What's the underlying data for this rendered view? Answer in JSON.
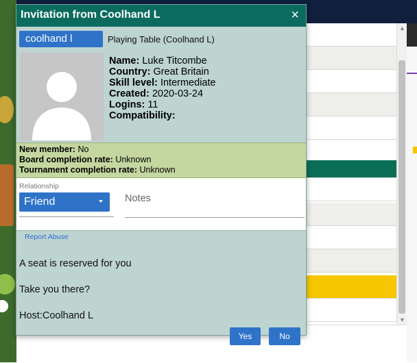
{
  "dialog": {
    "title": "Invitation from Coolhand L",
    "close_glyph": "×",
    "player_tag": "coolhand l",
    "table_label": "Playing Table (Coolhand L)"
  },
  "profile": {
    "name_label": "Name:",
    "name_value": "Luke Titcombe",
    "country_label": "Country:",
    "country_value": "Great Britain",
    "skill_label": "Skill level:",
    "skill_value": "Intermediate",
    "created_label": "Created:",
    "created_value": "2020-03-24",
    "logins_label": "Logins:",
    "logins_value": "11",
    "compat_label": "Compatibility:",
    "compat_value": ""
  },
  "stats": {
    "new_member_label": "New member:",
    "new_member_value": "No",
    "board_label": "Board completion rate:",
    "board_value": "Unknown",
    "tournament_label": "Tournament completion rate:",
    "tournament_value": "Unknown"
  },
  "relationship": {
    "label": "Relationship",
    "value": "Friend",
    "notes_placeholder": "Notes"
  },
  "report_abuse": "Report Abuse",
  "messages": {
    "line1": "A seat is reserved for you",
    "line2": "Take you there?",
    "line3": "Host:Coolhand L"
  },
  "buttons": {
    "yes": "Yes",
    "no": "No"
  },
  "icons": [
    "close-icon",
    "user-avatar-icon",
    "dropdown-caret-icon"
  ],
  "colors": {
    "title_bar": "#0a6b5e",
    "dialog_bg": "#bdd4d1",
    "stats_bg": "#c4d7a0",
    "button_blue": "#2f73c9",
    "link_blue": "#2f6fcf"
  }
}
